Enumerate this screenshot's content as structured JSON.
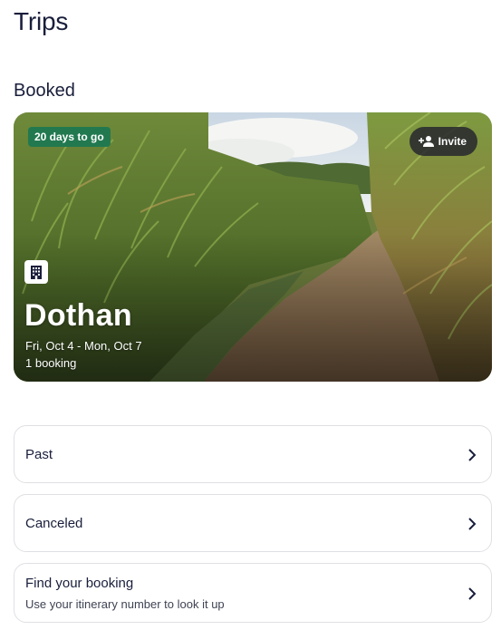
{
  "header": {
    "title": "Trips"
  },
  "booked": {
    "section_title": "Booked",
    "trip": {
      "countdown": "20 days to go",
      "invite_label": "Invite",
      "city": "Dothan",
      "dates": "Fri, Oct 4 - Mon, Oct 7",
      "bookings": "1 booking",
      "lodging_icon": "building-icon",
      "image": "cornfield-path-photo"
    }
  },
  "lists": {
    "past": {
      "label": "Past"
    },
    "canceled": {
      "label": "Canceled"
    },
    "find": {
      "label": "Find your booking",
      "sublabel": "Use your itinerary number to look it up"
    }
  },
  "colors": {
    "badge_green": "#227950",
    "text_primary": "#191e3b",
    "card_border": "#dfe0e4"
  }
}
